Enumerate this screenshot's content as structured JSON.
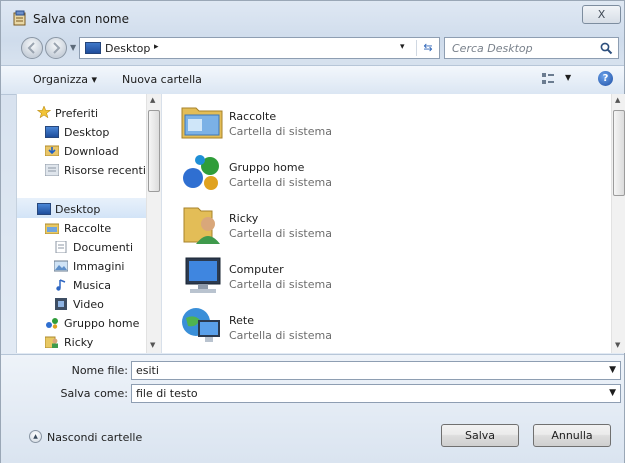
{
  "window": {
    "title": "Salva con nome",
    "close_label": "X"
  },
  "address": {
    "location": "Desktop",
    "separator": "▸",
    "dropdown": "▾"
  },
  "search": {
    "placeholder": "Cerca Desktop"
  },
  "toolbar": {
    "organize_label": "Organizza ▾",
    "new_folder_label": "Nuova cartella",
    "help_label": "?"
  },
  "sidebar": {
    "favorites": [
      {
        "label": "Preferiti",
        "icon": "star-icon"
      },
      {
        "label": "Desktop",
        "icon": "desktop-icon"
      },
      {
        "label": "Download",
        "icon": "download-folder-icon"
      },
      {
        "label": "Risorse recenti",
        "icon": "recent-places-icon"
      }
    ],
    "tree": [
      {
        "label": "Desktop",
        "icon": "desktop-icon",
        "selected": true
      },
      {
        "label": "Raccolte",
        "icon": "libraries-icon"
      },
      {
        "label": "Documenti",
        "icon": "documents-icon"
      },
      {
        "label": "Immagini",
        "icon": "pictures-icon"
      },
      {
        "label": "Musica",
        "icon": "music-icon"
      },
      {
        "label": "Video",
        "icon": "video-icon"
      },
      {
        "label": "Gruppo home",
        "icon": "homegroup-icon"
      },
      {
        "label": "Ricky",
        "icon": "user-folder-icon"
      }
    ]
  },
  "content": {
    "items": [
      {
        "name": "Raccolte",
        "type": "Cartella di sistema",
        "icon": "libraries-icon"
      },
      {
        "name": "Gruppo home",
        "type": "Cartella di sistema",
        "icon": "homegroup-icon"
      },
      {
        "name": "Ricky",
        "type": "Cartella di sistema",
        "icon": "user-folder-icon"
      },
      {
        "name": "Computer",
        "type": "Cartella di sistema",
        "icon": "computer-icon"
      },
      {
        "name": "Rete",
        "type": "Cartella di sistema",
        "icon": "network-icon"
      }
    ]
  },
  "form": {
    "filename_label": "Nome file:",
    "filename_value": "esiti",
    "filetype_label": "Salva come:",
    "filetype_value": "file di testo"
  },
  "footer": {
    "hide_folders_label": "Nascondi cartelle",
    "save_label": "Salva",
    "cancel_label": "Annulla"
  }
}
